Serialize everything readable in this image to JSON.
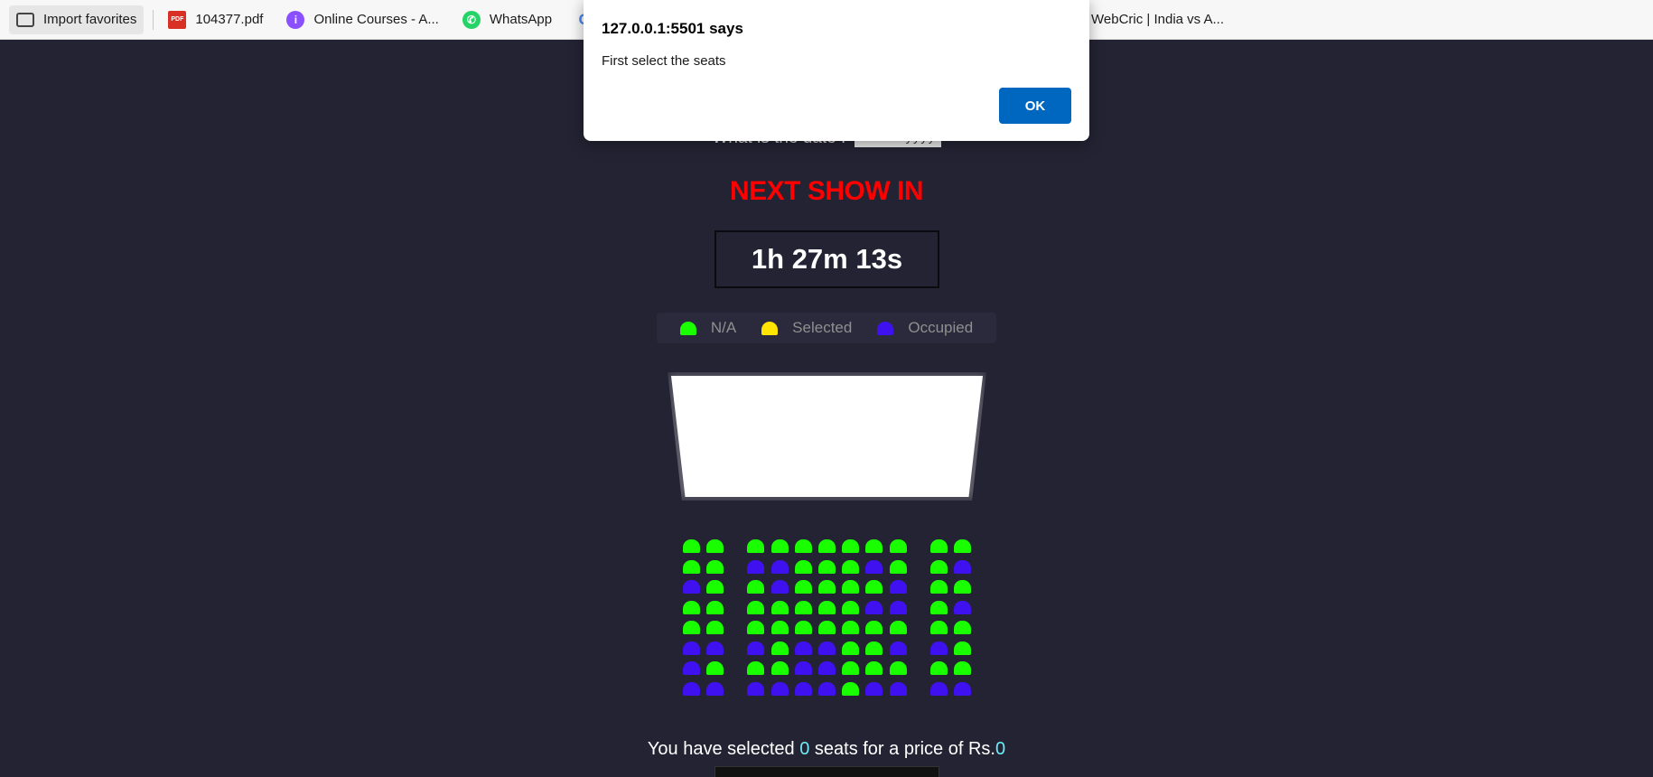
{
  "favorites": [
    {
      "label": "Import favorites",
      "icon": "folder-import-icon"
    },
    {
      "label": "104377.pdf",
      "icon": "pdf-icon"
    },
    {
      "label": "Online Courses - A...",
      "icon": "courses-icon"
    },
    {
      "label": "WhatsApp",
      "icon": "whatsapp-icon"
    },
    {
      "label": "G",
      "icon": "google-icon"
    },
    {
      "label": "WebCric | India vs A...",
      "icon": "webcric-icon"
    }
  ],
  "page": {
    "date_label": "What is the date :",
    "date_placeholder": "dd-mm-yyyy",
    "next_show_title": "NEXT SHOW IN",
    "countdown": "1h 27m 13s",
    "legend": [
      {
        "label": "N/A",
        "color": "#1aff00"
      },
      {
        "label": "Selected",
        "color": "#ffe500"
      },
      {
        "label": "Occupied",
        "color": "#4011f0"
      }
    ],
    "summary_prefix": "You have selected",
    "seat_count": "0",
    "summary_middle": "seats for a price of Rs.",
    "price": "0"
  },
  "seat_colors": {
    "na": "#1aff00",
    "occupied": "#4011f0",
    "selected": "#ffe500"
  },
  "seat_layout": {
    "note_legend": "N = N/A (green), O = Occupied (purple)",
    "rows": [
      "NN NNNNNNN NN",
      "NN OONNNON NO",
      "ON NONNNNO NN",
      "NN NNNNNOO NO",
      "NN NNNNNNN NN",
      "OO ONOONNO ON",
      "ON NNOONNN NN",
      "OO OOOONOO OO"
    ]
  },
  "dialog": {
    "title": "127.0.0.1:5501 says",
    "message": "First select the seats",
    "ok_label": "OK"
  }
}
